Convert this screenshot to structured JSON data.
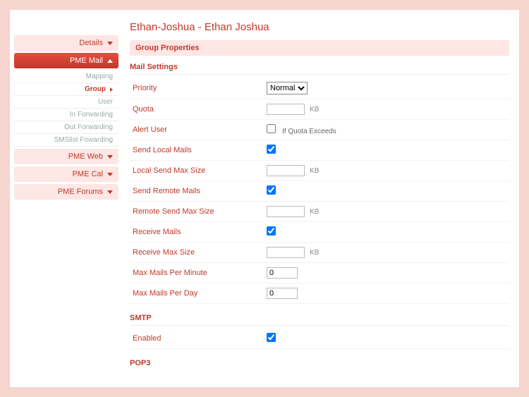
{
  "page_title": "Ethan-Joshua - Ethan Joshua",
  "sidebar": {
    "details": "Details",
    "pme_mail": "PME Mail",
    "sub": {
      "mapping": "Mapping",
      "group": "Group",
      "user": "User",
      "in_fwd": "In Forwarding",
      "out_fwd": "Out Forwarding",
      "sms_fwd": "SMSlist Fowarding"
    },
    "pme_web": "PME Web",
    "pme_cal": "PME Cal",
    "pme_forums": "PME Forums"
  },
  "section": {
    "group_props": "Group Properties",
    "mail_settings": "Mail Settings",
    "smtp": "SMTP",
    "pop3": "POP3"
  },
  "labels": {
    "priority": "Priority",
    "quota": "Quota",
    "alert_user": "Alert User",
    "if_quota": "If Quota Exceeds",
    "send_local": "Send Local Mails",
    "local_max": "Local Send Max Size",
    "send_remote": "Send Remote Mails",
    "remote_max": "Remote Send Max Size",
    "receive": "Receive Mails",
    "receive_max": "Receive Max Size",
    "per_min": "Max Mails Per Minute",
    "per_day": "Max Mails Per Day",
    "enabled": "Enabled"
  },
  "values": {
    "priority_selected": "Normal",
    "quota": "",
    "alert_user": false,
    "send_local": true,
    "local_max": "",
    "send_remote": true,
    "remote_max": "",
    "receive": true,
    "receive_max": "",
    "per_min": "0",
    "per_day": "0",
    "smtp_enabled": true
  },
  "units": {
    "kb": "KB"
  }
}
